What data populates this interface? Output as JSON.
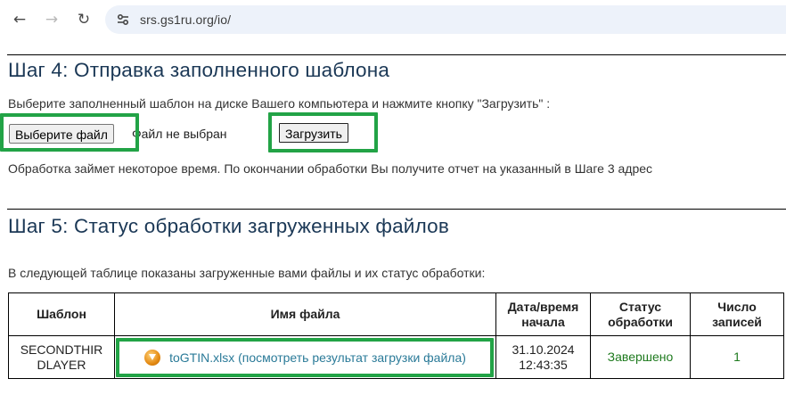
{
  "browser": {
    "back_icon": "←",
    "forward_icon": "→",
    "reload_icon": "↻",
    "url": "srs.gs1ru.org/io/"
  },
  "step4": {
    "title": "Шаг 4: Отправка заполненного шаблона",
    "instruction": "Выберите заполненный шаблон на диске Вашего компьютера и нажмите кнопку \"Загрузить\" :",
    "choose_file_label": "Выберите файл",
    "file_status": "Файл не выбран",
    "upload_label": "Загрузить",
    "note": "Обработка займет некоторое время. По окончании обработки Вы получите отчет на указанный в Шаге 3 адрес"
  },
  "step5": {
    "title": "Шаг 5: Статус обработки загруженных файлов",
    "intro": "В следующей таблице показаны загруженные вами файлы и их статус обработки:",
    "columns": [
      {
        "line1": "Шаблон",
        "line2": ""
      },
      {
        "line1": "Имя файла",
        "line2": ""
      },
      {
        "line1": "Дата/время",
        "line2": "начала"
      },
      {
        "line1": "Статус",
        "line2": "обработки"
      },
      {
        "line1": "Число",
        "line2": "записей"
      }
    ],
    "rows": [
      {
        "template_line1": "SECONDTHIR",
        "template_line2": "DLAYER",
        "file_link": "toGTIN.xlsx (посмотреть результат загрузки файла)",
        "date": "31.10.2024",
        "time": "12:43:35",
        "status": "Завершено",
        "records": "1"
      }
    ]
  },
  "colors": {
    "highlight": "#22a346",
    "heading": "#1b3856",
    "link": "#2a7a98",
    "status_done": "#1e7a1e"
  }
}
